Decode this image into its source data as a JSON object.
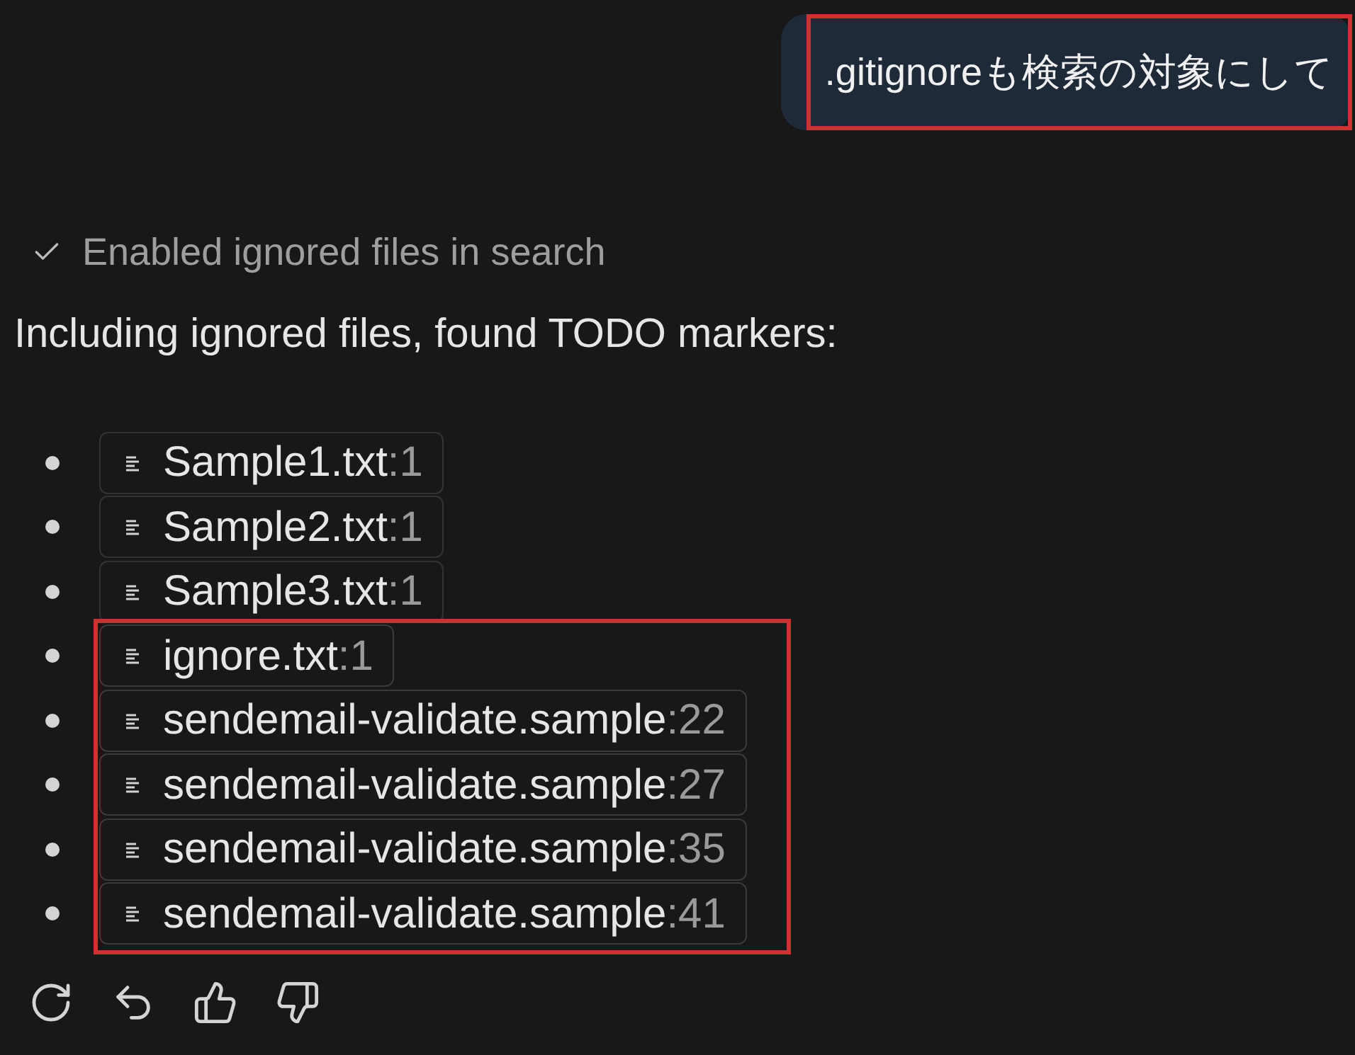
{
  "user_message": {
    "text": ".gitignoreも検索の対象にして",
    "highlighted": true
  },
  "status": {
    "text": "Enabled ignored files in search",
    "done": true
  },
  "response": {
    "intro": "Including ignored files, found TODO markers:",
    "files": [
      {
        "name": "Sample1.txt",
        "line": ":1",
        "highlighted": false
      },
      {
        "name": "Sample2.txt",
        "line": ":1",
        "highlighted": false
      },
      {
        "name": "Sample3.txt",
        "line": ":1",
        "highlighted": false
      },
      {
        "name": "ignore.txt",
        "line": ":1",
        "highlighted": true
      },
      {
        "name": "sendemail-validate.sample",
        "line": ":22",
        "highlighted": true
      },
      {
        "name": "sendemail-validate.sample",
        "line": ":27",
        "highlighted": true
      },
      {
        "name": "sendemail-validate.sample",
        "line": ":35",
        "highlighted": true
      },
      {
        "name": "sendemail-validate.sample",
        "line": ":41",
        "highlighted": true
      }
    ]
  },
  "actions": [
    {
      "kind": "retry"
    },
    {
      "kind": "undo"
    },
    {
      "kind": "like"
    },
    {
      "kind": "dislike"
    }
  ]
}
